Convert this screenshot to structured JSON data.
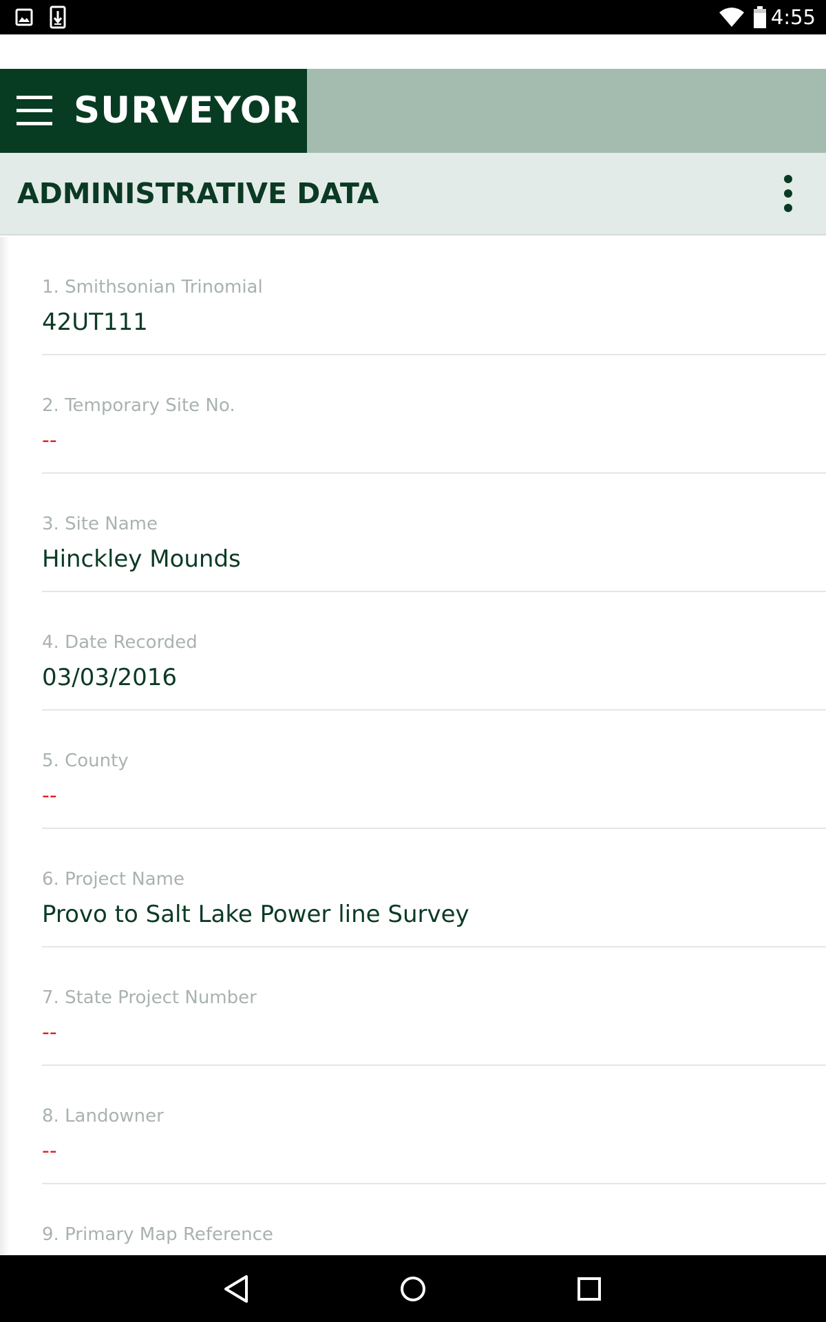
{
  "status_bar": {
    "time": "4:55",
    "icons": [
      "image-notification-icon",
      "download-notification-icon",
      "wifi-icon",
      "battery-icon"
    ]
  },
  "header": {
    "app_title": "SURVEYOR",
    "menu_icon": "hamburger-menu-icon",
    "brand_color": "#073c22",
    "header_accent_color": "#a4bcb0"
  },
  "section": {
    "title": "ADMINISTRATIVE DATA",
    "overflow_icon": "more-vert-icon",
    "background_color": "#e3ebe8"
  },
  "fields": [
    {
      "label": "1. Smithsonian Trinomial",
      "value": "42UT111"
    },
    {
      "label": "2. Temporary Site No.",
      "value": "--"
    },
    {
      "label": "3. Site Name",
      "value": "Hinckley Mounds"
    },
    {
      "label": "4. Date Recorded",
      "value": "03/03/2016"
    },
    {
      "label": "5. County",
      "value": "--"
    },
    {
      "label": "6. Project Name",
      "value": "Provo to Salt Lake Power line Survey"
    },
    {
      "label": "7. State Project Number",
      "value": "--"
    },
    {
      "label": "8. Landowner",
      "value": "--"
    },
    {
      "label": "9. Primary Map Reference",
      "value": ""
    }
  ],
  "colors": {
    "value_text": "#0b3a24",
    "empty_value": "#e02020",
    "label_text": "#a9b3ae"
  },
  "nav_bar": {
    "buttons": [
      "back-icon",
      "home-icon",
      "recents-icon"
    ]
  }
}
